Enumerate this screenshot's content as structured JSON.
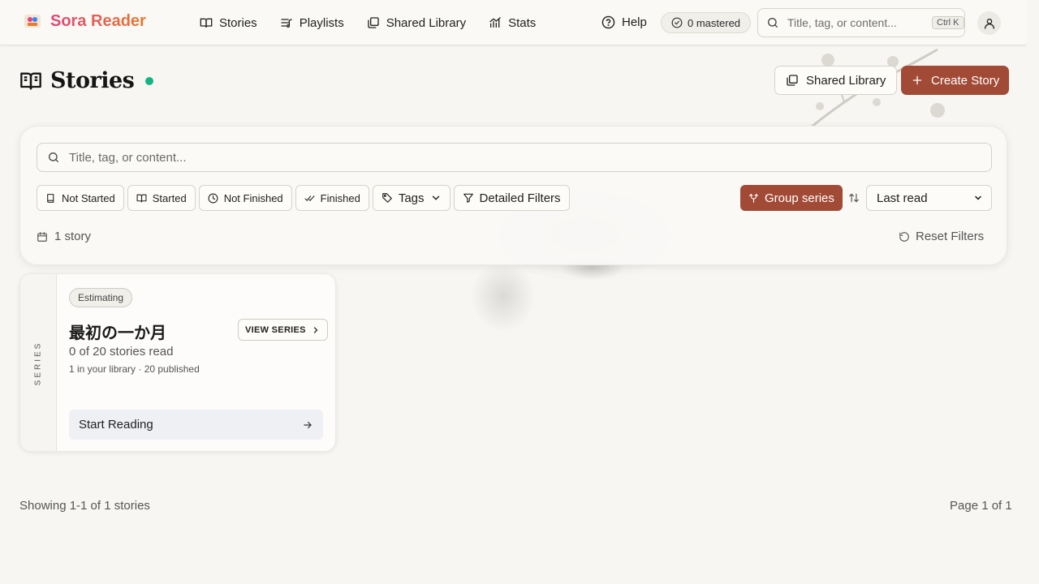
{
  "brand": {
    "name": "Sora Reader"
  },
  "nav": {
    "items": [
      {
        "label": "Stories",
        "icon": "book-open-icon"
      },
      {
        "label": "Playlists",
        "icon": "playlist-icon"
      },
      {
        "label": "Shared Library",
        "icon": "library-icon"
      },
      {
        "label": "Stats",
        "icon": "chart-icon"
      }
    ],
    "help_label": "Help",
    "mastered_label": "0 mastered",
    "search_placeholder": "Title, tag, or content...",
    "search_shortcut": "Ctrl K"
  },
  "page": {
    "title": "Stories",
    "shared_library_button": "Shared Library",
    "create_story_button": "Create Story"
  },
  "filters": {
    "search_placeholder": "Title, tag, or content...",
    "status_chips": [
      {
        "label": "Not Started",
        "icon": "book-icon"
      },
      {
        "label": "Started",
        "icon": "book-open-icon"
      },
      {
        "label": "Not Finished",
        "icon": "clock-icon"
      },
      {
        "label": "Finished",
        "icon": "double-check-icon"
      }
    ],
    "tags_label": "Tags",
    "detailed_filters_label": "Detailed Filters",
    "group_series_label": "Group series",
    "sort_value": "Last read",
    "count_label": "1 story",
    "reset_label": "Reset Filters"
  },
  "series_card": {
    "side_label": "SERIES",
    "badge": "Estimating",
    "title": "最初の一か月",
    "view_series_label": "VIEW SERIES",
    "progress": "0 of 20 stories read",
    "meta": "1 in your library · 20 published",
    "start_label": "Start Reading"
  },
  "footer": {
    "showing": "Showing 1-1 of 1 stories",
    "page": "Page 1 of 1"
  },
  "colors": {
    "accent": "#a14a35",
    "live_dot": "#15b383",
    "brand_gradient_start": "#e0457b",
    "brand_gradient_end": "#e87b2f"
  }
}
